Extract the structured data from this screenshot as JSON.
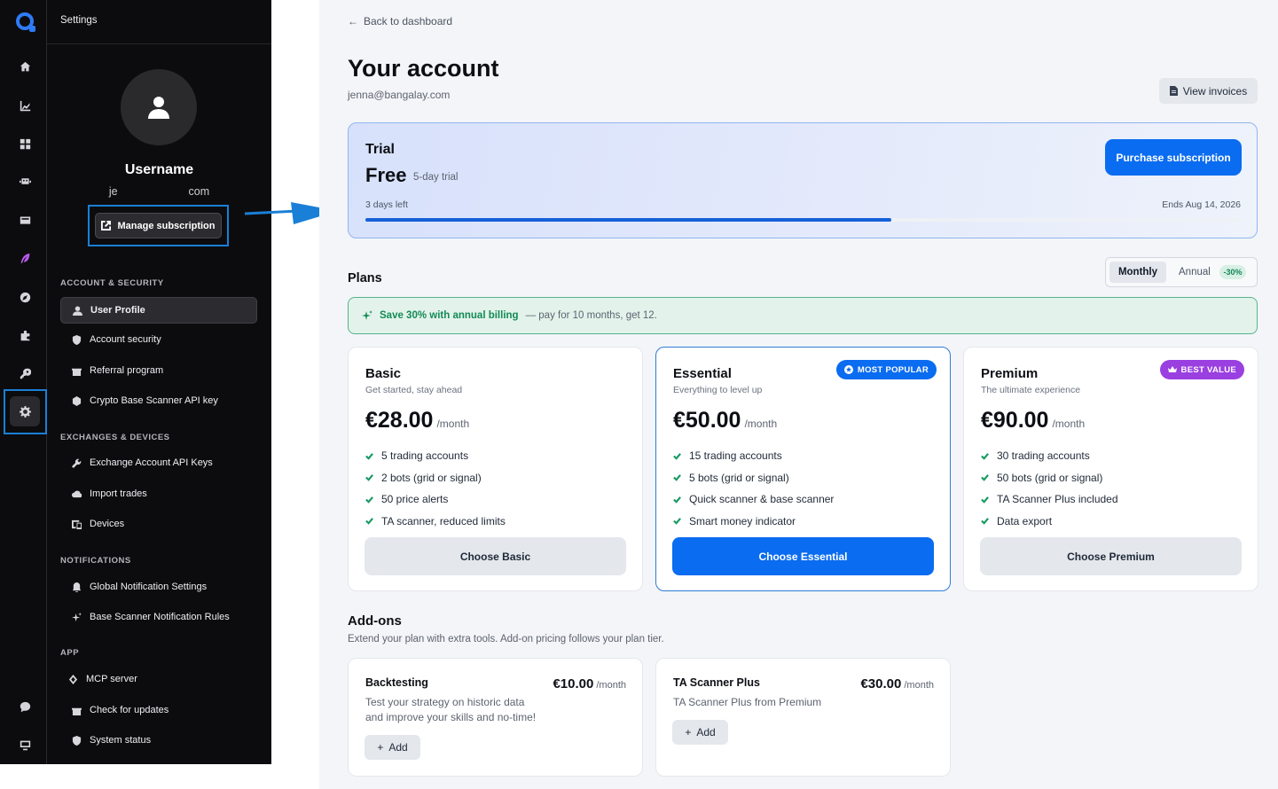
{
  "sidebar": {
    "header": "Settings",
    "username": "Username",
    "email_start": "je",
    "email_end": "com",
    "manage_label": "Manage subscription",
    "sections": [
      {
        "title": "ACCOUNT & SECURITY",
        "items": [
          {
            "label": "User Profile",
            "icon": "user-icon",
            "active": true
          },
          {
            "label": "Account security",
            "icon": "shield-icon"
          },
          {
            "label": "Referral program",
            "icon": "gift-icon"
          },
          {
            "label": "Crypto Base Scanner API key",
            "icon": "cube-icon"
          }
        ]
      },
      {
        "title": "EXCHANGES & DEVICES",
        "items": [
          {
            "label": "Exchange Account API Keys",
            "icon": "wrench-icon"
          },
          {
            "label": "Import trades",
            "icon": "cloud-upload-icon"
          },
          {
            "label": "Devices",
            "icon": "devices-icon"
          }
        ]
      },
      {
        "title": "NOTIFICATIONS",
        "items": [
          {
            "label": "Global Notification Settings",
            "icon": "bell-icon"
          },
          {
            "label": "Base Scanner Notification Rules",
            "icon": "sparkle-icon"
          }
        ]
      },
      {
        "title": "APP",
        "items": [
          {
            "label": "MCP server",
            "icon": "mcp-icon"
          },
          {
            "label": "Check for updates",
            "icon": "gift-icon"
          },
          {
            "label": "System status",
            "icon": "shield-check-icon"
          }
        ]
      }
    ]
  },
  "main": {
    "back_label": "Back to dashboard",
    "title": "Your account",
    "email": "jenna@bangalay.com",
    "invoices_label": "View invoices",
    "trial": {
      "label": "Trial",
      "plan": "Free",
      "plan_sub": "5-day trial",
      "days_left": "3 days left",
      "ends": "Ends Aug 14, 2026",
      "progress": 0.6,
      "purchase_label": "Purchase subscription"
    },
    "plans_title": "Plans",
    "billing": {
      "monthly": "Monthly",
      "annual": "Annual",
      "discount": "-30%",
      "selected": "Monthly"
    },
    "save_banner": {
      "strong": "Save 30% with annual billing",
      "rest": "— pay for 10 months, get 12."
    },
    "plans": [
      {
        "name": "Basic",
        "sub": "Get started, stay ahead",
        "price": "€28.00",
        "per": "/month",
        "features": [
          "5 trading accounts",
          "2 bots (grid or signal)",
          "50 price alerts",
          "TA scanner, reduced limits"
        ],
        "button": "Choose Basic",
        "badge": ""
      },
      {
        "name": "Essential",
        "sub": "Everything to level up",
        "price": "€50.00",
        "per": "/month",
        "features": [
          "15 trading accounts",
          "5 bots (grid or signal)",
          "Quick scanner & base scanner",
          "Smart money indicator"
        ],
        "button": "Choose Essential",
        "badge": "MOST POPULAR"
      },
      {
        "name": "Premium",
        "sub": "The ultimate experience",
        "price": "€90.00",
        "per": "/month",
        "features": [
          "30 trading accounts",
          "50 bots (grid or signal)",
          "TA Scanner Plus included",
          "Data export"
        ],
        "button": "Choose Premium",
        "badge": "BEST VALUE"
      }
    ],
    "addons_title": "Add-ons",
    "addons_sub": "Extend your plan with extra tools. Add-on pricing follows your plan tier.",
    "addons": [
      {
        "name": "Backtesting",
        "price": "€10.00",
        "per": "/month",
        "desc": "Test your strategy on historic data and improve your skills and no-time!",
        "add": "Add"
      },
      {
        "name": "TA Scanner Plus",
        "price": "€30.00",
        "per": "/month",
        "desc": "TA Scanner Plus from Premium",
        "add": "Add"
      }
    ]
  },
  "colors": {
    "accent": "#0a6cf0",
    "success": "#138a55",
    "purple": "#9a3fe0",
    "highlight": "#1a7fd6"
  }
}
